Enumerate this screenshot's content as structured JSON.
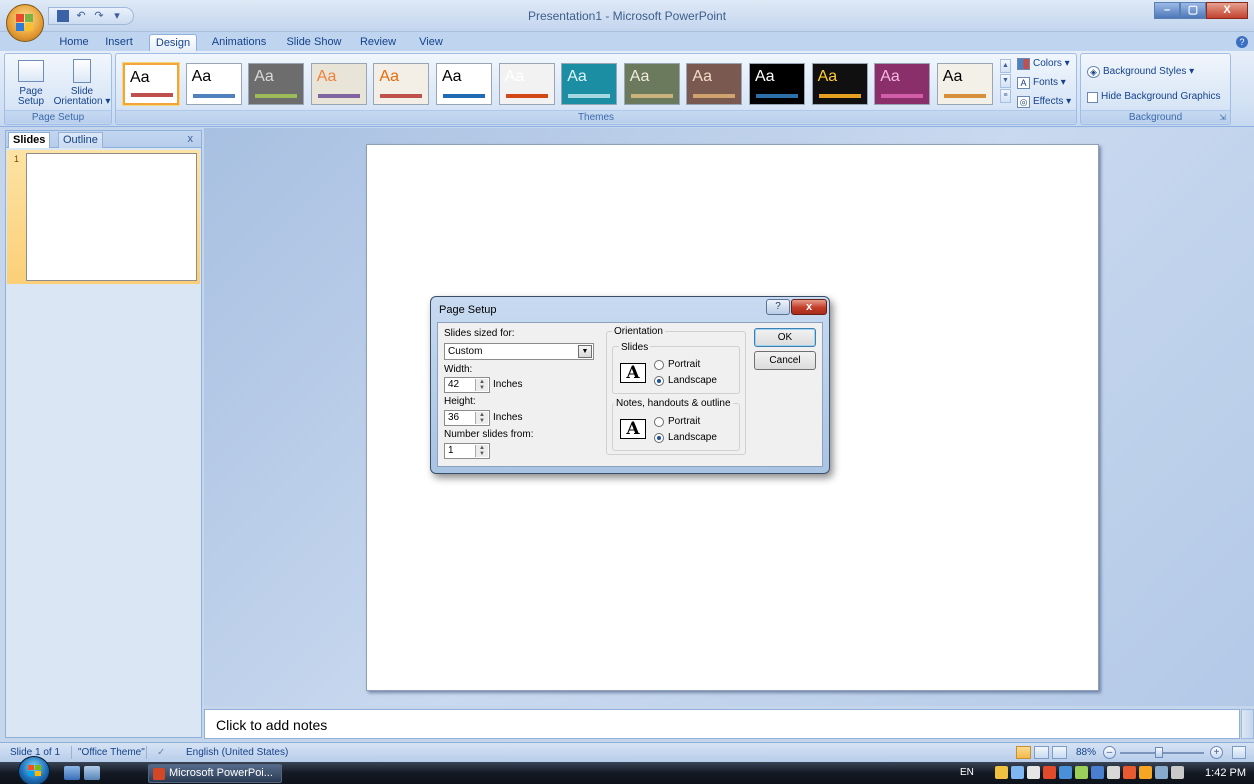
{
  "window": {
    "title": "Presentation1 - Microsoft PowerPoint",
    "minimize_glyph": "–",
    "maximize_glyph": "▢",
    "close_glyph": "X"
  },
  "quick_access": {
    "save_icon": "save-icon",
    "undo_glyph": "↶",
    "redo_glyph": "↷",
    "customize_glyph": "▾"
  },
  "ribbon_tabs": [
    "Home",
    "Insert",
    "Design",
    "Animations",
    "Slide Show",
    "Review",
    "View"
  ],
  "active_tab": "Design",
  "ribbon": {
    "page_setup_group": {
      "label": "Page Setup",
      "page_setup_line1": "Page",
      "page_setup_line2": "Setup",
      "orientation_line1": "Slide",
      "orientation_line2": "Orientation ▾"
    },
    "themes_group": {
      "label": "Themes",
      "theme_sample": "Aa",
      "themes": [
        {
          "bg": "#ffffff",
          "fg": "#000000",
          "bar": "#c0504d"
        },
        {
          "bg": "#ffffff",
          "fg": "#000000",
          "bar": "#4f81bd"
        },
        {
          "bg": "#6d6d6d",
          "fg": "#d9d9d9",
          "bar": "#9bbb59"
        },
        {
          "bg": "#e9e4d8",
          "fg": "#ee7f3a",
          "bar": "#8064a2"
        },
        {
          "bg": "#f4efe6",
          "fg": "#e46c0a",
          "bar": "#c0504d"
        },
        {
          "bg": "#ffffff",
          "fg": "#000000",
          "bar": "#1f6bb5"
        },
        {
          "bg": "#f2f2f2",
          "fg": "#ffffff",
          "bar": "#d34817"
        },
        {
          "bg": "#1b8ea3",
          "fg": "#dff5f9",
          "bar": "#a5d8e0"
        },
        {
          "bg": "#6b7a5c",
          "fg": "#f0eadb",
          "bar": "#c9b27b"
        },
        {
          "bg": "#7a5a50",
          "fg": "#f3dcc9",
          "bar": "#d0a36f"
        },
        {
          "bg": "#000000",
          "fg": "#ffffff",
          "bar": "#2d6fa8"
        },
        {
          "bg": "#101010",
          "fg": "#ffcc33",
          "bar": "#e6a01f"
        },
        {
          "bg": "#8b2f6b",
          "fg": "#f2b9e0",
          "bar": "#d15fa8"
        },
        {
          "bg": "#f3f0e8",
          "fg": "#000000",
          "bar": "#d78f3a"
        }
      ],
      "colors_label": "Colors ▾",
      "fonts_label": "Fonts ▾",
      "effects_label": "Effects ▾"
    },
    "background_group": {
      "label": "Background",
      "background_styles": "Background Styles ▾",
      "hide_graphics": "Hide Background Graphics"
    }
  },
  "slides_pane": {
    "tab_slides": "Slides",
    "tab_outline": "Outline",
    "close_glyph": "x",
    "thumbnail_number": "1"
  },
  "notes": {
    "placeholder": "Click to add notes"
  },
  "status_bar": {
    "slide_info": "Slide 1 of 1",
    "theme": "\"Office Theme\"",
    "language": "English (United States)",
    "zoom": "88%"
  },
  "dialog": {
    "title": "Page Setup",
    "help_glyph": "?",
    "close_glyph": "x",
    "slides_sized_for_label": "Slides sized for:",
    "slides_sized_for_value": "Custom",
    "width_label": "Width:",
    "width_value": "42",
    "width_unit": "Inches",
    "height_label": "Height:",
    "height_value": "36",
    "height_unit": "Inches",
    "number_from_label": "Number slides from:",
    "number_from_value": "1",
    "orientation_label": "Orientation",
    "slides_section": "Slides",
    "notes_section": "Notes, handouts & outline",
    "portrait": "Portrait",
    "landscape": "Landscape",
    "orientation_sample": "A",
    "ok": "OK",
    "cancel": "Cancel"
  },
  "taskbar": {
    "task_label": "Microsoft PowerPoi...",
    "language": "EN",
    "clock": "1:42 PM"
  }
}
